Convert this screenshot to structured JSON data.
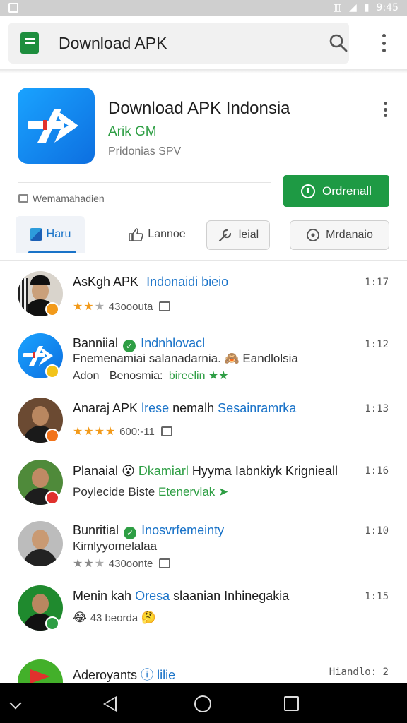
{
  "status_bar": {
    "time": "9:45"
  },
  "app_bar": {
    "title": "Download APK"
  },
  "app_header": {
    "name": "Download APK Indonsia",
    "developer": "Arik GM",
    "subtitle": "Pridonias SPV",
    "meta": "Wemamahadien",
    "install_label": "Ordrenall"
  },
  "tabs": [
    {
      "label": "Haru"
    },
    {
      "label": "Lannoe"
    },
    {
      "label": "leial"
    },
    {
      "label": "Mrdanaio"
    }
  ],
  "feed": [
    {
      "name": "AsKgh APK",
      "tag": "Indonaidi bieio",
      "time": "1:17",
      "rating_stars": 2,
      "rating_text": "43ooouta",
      "badge_color": "#f29a1a"
    },
    {
      "name": "Banniial",
      "tag": "Indnhlovacl",
      "line2": "Fnemenamiai salanadarnia. 🙈 Eandlolsia",
      "line3_a": "Adon",
      "line3_b": "Benosmia:",
      "line3_c": "bireelin",
      "time": "1:12",
      "badge_color": "#f2c31a"
    },
    {
      "name": "Anaraj APK",
      "tag": "lrese",
      "mid": "nemalh",
      "tag2": "Sesainramrka",
      "time": "1:13",
      "rating_stars": 4,
      "rating_text": "600:-11",
      "badge_color": "#f2731a"
    },
    {
      "name": "Planaial",
      "emoji": "😮",
      "highlight": "Dkamiarl",
      "rest": "Hyyma Iabnkiyk Krignieall",
      "line2_a": "Poylecide Biste",
      "line2_b": "Etenervlak",
      "time": "1:16",
      "badge_color": "#e0312d"
    },
    {
      "name": "Bunritial",
      "tag": "Inosvrfemeinty",
      "line2": "Kimlyyomelalaa",
      "time": "1:10",
      "rating_stars": 3,
      "rating_text": "430oonte"
    },
    {
      "name": "Menin kah",
      "tag": "Oresa",
      "rest": "slaanian Inhinegakia",
      "line2_text": "43 beorda",
      "time": "1:15",
      "badge_color": "#2e9e44"
    },
    {
      "name": "Aderoyants",
      "tag": "lilie",
      "time": "Hiandlo: 2"
    }
  ]
}
